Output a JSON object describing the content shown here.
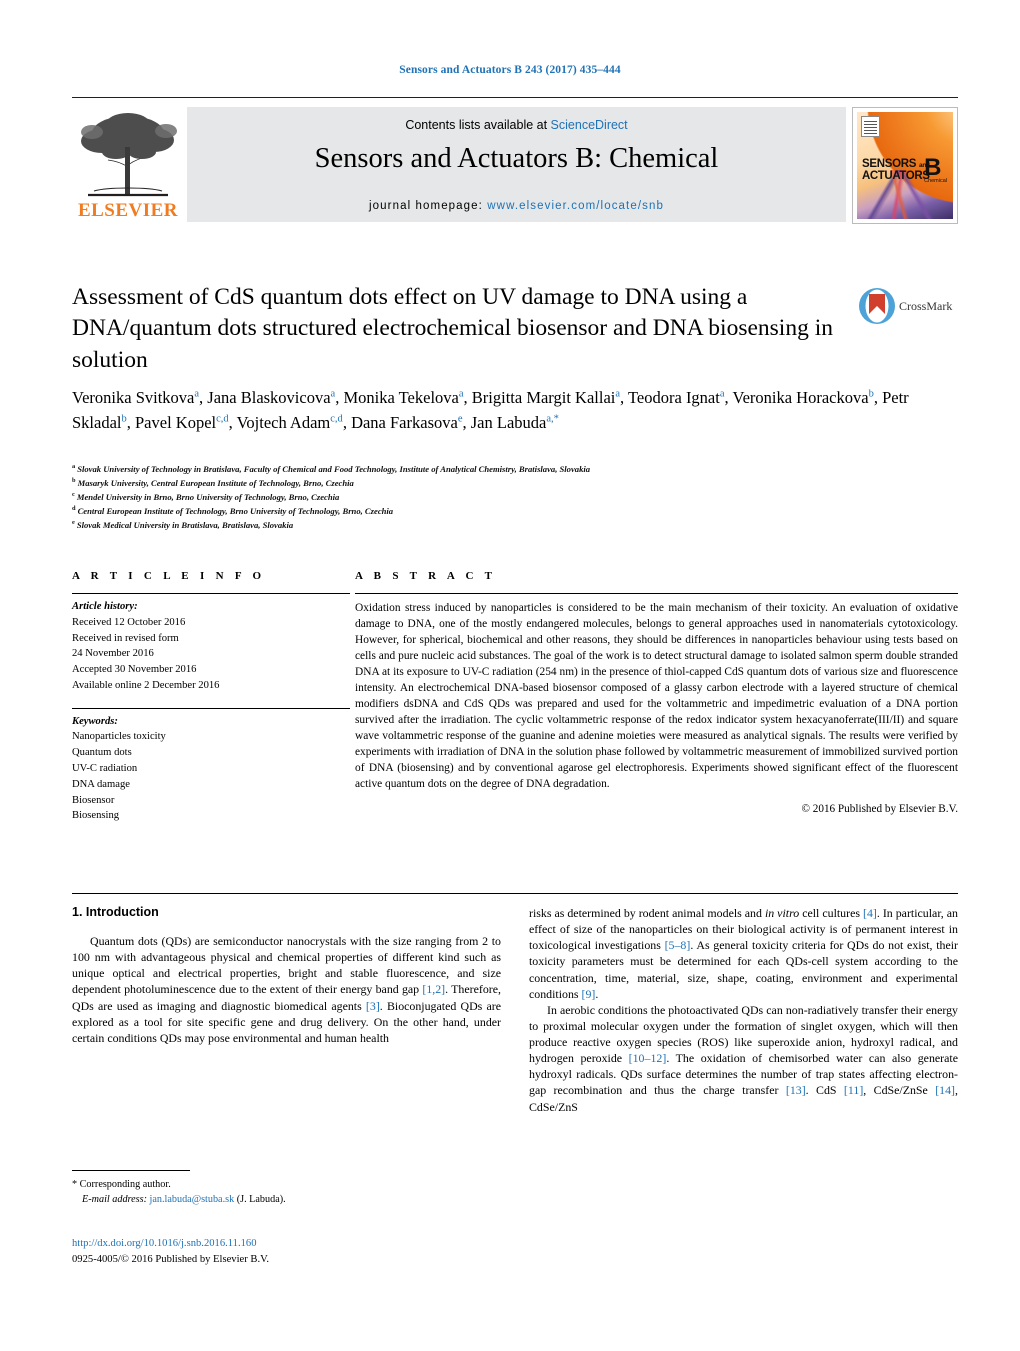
{
  "running_head": "Sensors and Actuators B 243 (2017) 435–444",
  "masthead": {
    "publisher": "ELSEVIER",
    "contents_prefix": "Contents lists available at ",
    "sciencedirect": "ScienceDirect",
    "journal_title": "Sensors and Actuators B: Chemical",
    "homepage_label": "journal homepage: ",
    "homepage_url": "www.elsevier.com/locate/snb",
    "cover": {
      "line1": "SENSORS",
      "line1_small": "and",
      "line2": "ACTUATORS",
      "letter": "B",
      "letter_sub": "Chemical"
    }
  },
  "article": {
    "title": "Assessment of CdS quantum dots effect on UV damage to DNA using a DNA/quantum dots structured electrochemical biosensor and DNA biosensing in solution",
    "crossmark_label": "CrossMark",
    "authors_html": "Veronika Svitkova<sup>a</sup>, Jana Blaskovicova<sup>a</sup>, Monika Tekelova<sup>a</sup>, Brigitta Margit Kallai<sup>a</sup>, Teodora Ignat<sup>a</sup>, Veronika Horackova<sup>b</sup>, Petr Skladal<sup>b</sup>, Pavel Kopel<sup>c,d</sup>, Vojtech Adam<sup>c,d</sup>, Dana Farkasova<sup>e</sup>, Jan Labuda<sup>a,*</sup>",
    "affiliations": [
      {
        "mark": "a",
        "text": "Slovak University of Technology in Bratislava, Faculty of Chemical and Food Technology, Institute of Analytical Chemistry, Bratislava, Slovakia"
      },
      {
        "mark": "b",
        "text": "Masaryk University, Central European Institute of Technology, Brno, Czechia"
      },
      {
        "mark": "c",
        "text": "Mendel University in Brno, Brno University of Technology, Brno, Czechia"
      },
      {
        "mark": "d",
        "text": "Central European Institute of Technology, Brno University of Technology, Brno, Czechia"
      },
      {
        "mark": "e",
        "text": "Slovak Medical University in Bratislava, Bratislava, Slovakia"
      }
    ]
  },
  "article_info": {
    "heading": "A R T I C L E   I N F O",
    "history_label": "Article history:",
    "history": [
      "Received 12 October 2016",
      "Received in revised form",
      "24 November 2016",
      "Accepted 30 November 2016",
      "Available online 2 December 2016"
    ],
    "keywords_label": "Keywords:",
    "keywords": [
      "Nanoparticles toxicity",
      "Quantum dots",
      "UV-C radiation",
      "DNA damage",
      "Biosensor",
      "Biosensing"
    ]
  },
  "abstract": {
    "heading": "A B S T R A C T",
    "text": "Oxidation stress induced by nanoparticles is considered to be the main mechanism of their toxicity. An evaluation of oxidative damage to DNA, one of the mostly endangered molecules, belongs to general approaches used in nanomaterials cytotoxicology. However, for spherical, biochemical and other reasons, they should be differences in nanoparticles behaviour using tests based on cells and pure nucleic acid substances. The goal of the work is to detect structural damage to isolated salmon sperm double stranded DNA at its exposure to UV-C radiation (254 nm) in the presence of thiol-capped CdS quantum dots of various size and fluorescence intensity. An electrochemical DNA-based biosensor composed of a glassy carbon electrode with a layered structure of chemical modifiers dsDNA and CdS QDs was prepared and used for the voltammetric and impedimetric evaluation of a DNA portion survived after the irradiation. The cyclic voltammetric response of the redox indicator system hexacyanoferrate(III/II) and square wave voltammetric response of the guanine and adenine moieties were measured as analytical signals. The results were verified by experiments with irradiation of DNA in the solution phase followed by voltammetric measurement of immobilized survived portion of DNA (biosensing) and by conventional agarose gel electrophoresis. Experiments showed significant effect of the fluorescent active quantum dots on the degree of DNA degradation.",
    "copyright": "© 2016 Published by Elsevier B.V."
  },
  "body": {
    "section_heading": "1.  Introduction",
    "left_paragraph_html": "Quantum dots (QDs) are semiconductor nanocrystals with the size ranging from 2 to 100 nm with advantageous physical and chemical properties of different kind such as unique optical and electrical properties, bright and stable fluorescence, and size dependent photoluminescence due to the extent of their energy band gap <span class=\"ref\">[1,2]</span>. Therefore, QDs are used as imaging and diagnostic biomedical agents <span class=\"ref\">[3]</span>. Bioconjugated QDs are explored as a tool for site specific gene and drug delivery. On the other hand, under certain conditions QDs may pose environmental and human health",
    "right_paragraph1_html": "risks as determined by rodent animal models and <span class=\"ital\">in vitro</span> cell cultures <span class=\"ref\">[4]</span>. In particular, an effect of size of the nanoparticles on their biological activity is of permanent interest in toxicological investigations <span class=\"ref\">[5–8]</span>. As general toxicity criteria for QDs do not exist, their toxicity parameters must be determined for each QDs-cell system according to the concentration, time, material, size, shape, coating, environment and experimental conditions <span class=\"ref\">[9]</span>.",
    "right_paragraph2_html": "In aerobic conditions the photoactivated QDs can non-radiatively transfer their energy to proximal molecular oxygen under the formation of singlet oxygen, which will then produce reactive oxygen species (ROS) like superoxide anion, hydroxyl radical, and hydrogen peroxide <span class=\"ref\">[10–12]</span>. The oxidation of chemisorbed water can also generate hydroxyl radicals. QDs surface determines the number of trap states affecting electron-gap recombination and thus the charge transfer <span class=\"ref\">[13]</span>. CdS <span class=\"ref\">[11]</span>, CdSe/ZnSe <span class=\"ref\">[14]</span>, CdSe/ZnS"
  },
  "footer": {
    "corresponding_marker": "*",
    "corresponding_label": "Corresponding author.",
    "email_label": "E-mail address:",
    "email": "jan.labuda@stuba.sk",
    "email_suffix": "(J. Labuda).",
    "doi": "http://dx.doi.org/10.1016/j.snb.2016.11.160",
    "issn_line": "0925-4005/© 2016 Published by Elsevier B.V."
  },
  "colors": {
    "link": "#1f72b5",
    "elsevier_orange": "#f07c22",
    "banner_bg": "#e6e7e8"
  }
}
